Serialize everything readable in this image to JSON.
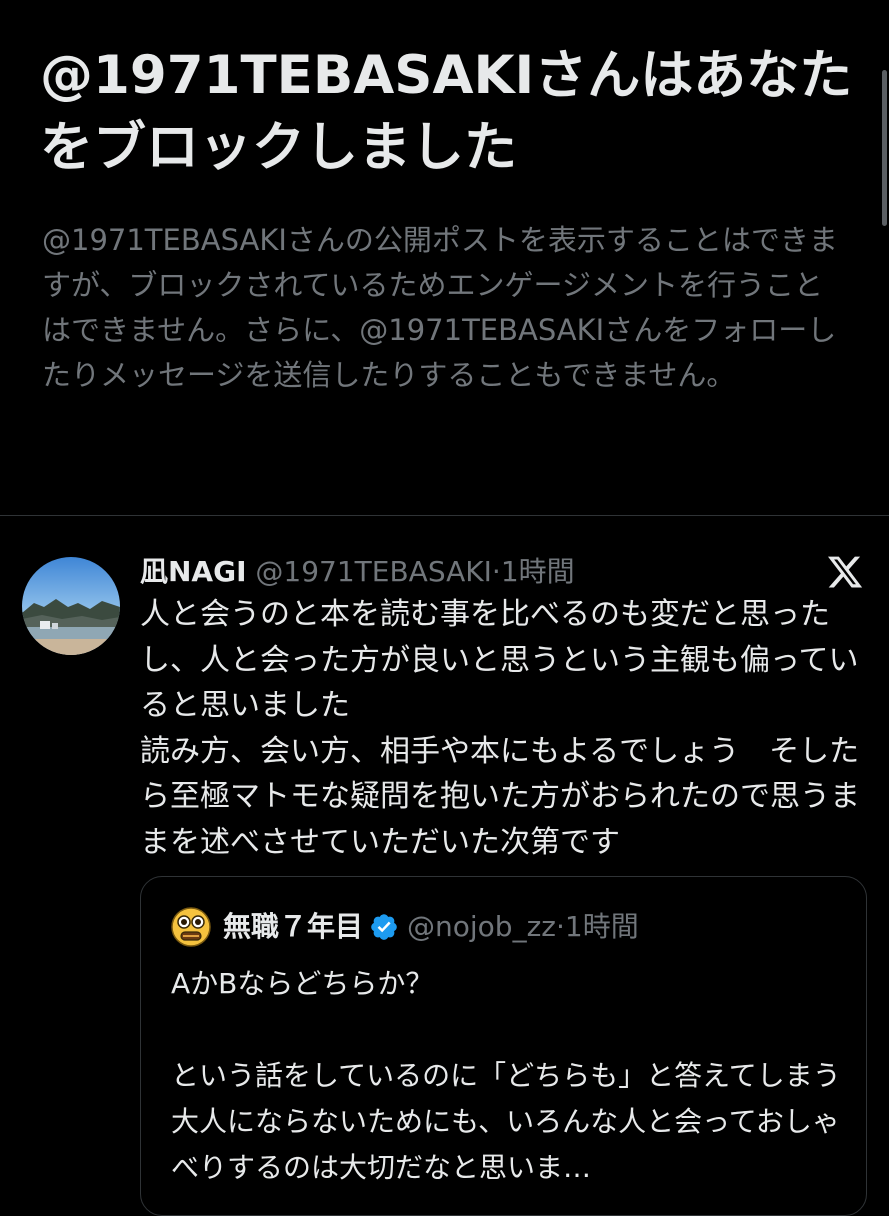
{
  "block_notice": {
    "title": "@1971TEBASAKIさんはあなたをブロックしました",
    "description": "@1971TEBASAKIさんの公開ポストを表示することはできますが、ブロックされているためエンゲージメントを行うことはできません。さらに、@1971TEBASAKIさんをフォローしたりメッセージを送信したりすることもできません。"
  },
  "tweet": {
    "author_name": "凪NAGI",
    "handle": "@1971TEBASAKI",
    "separator": "·",
    "time": "1時間",
    "text": "人と会うのと本を読む事を比べるのも変だと思ったし、人と会った方が良いと思うという主観も偏っていると思いました\n読み方、会い方、相手や本にもよるでしょう　そしたら至極マトモな疑問を抱いた方がおられたので思うままを述べさせていただいた次第です",
    "quote": {
      "author_name": "無職７年目",
      "handle": "@nojob_zz",
      "separator": "·",
      "time": "1時間",
      "text": "AかBならどちらか？\n\nという話をしているのに「どちらも」と答えてしまう大人にならないためにも、いろんな人と会っておしゃべりするのは大切だなと思いま…"
    }
  },
  "icons": {
    "x_logo": "x-logo-icon",
    "verified": "verified-badge-icon",
    "quote_avatar": "emoji-face-avatar"
  },
  "colors": {
    "background": "#000000",
    "primary_text": "#e7e9ea",
    "secondary_text": "#71767b",
    "divider": "#2f3336",
    "verified_blue": "#1d9bf0"
  }
}
